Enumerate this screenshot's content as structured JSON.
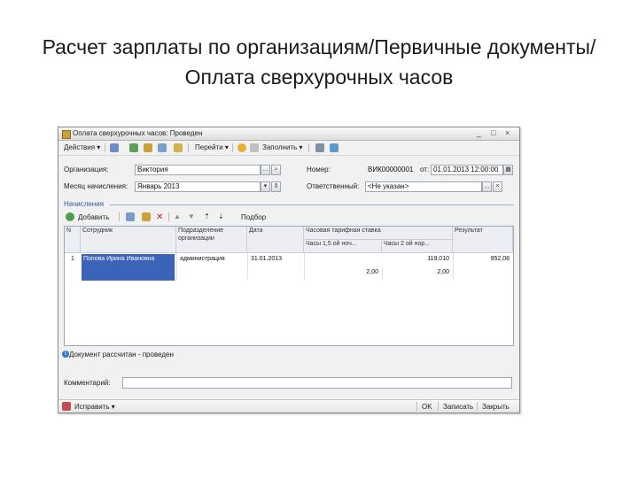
{
  "slide": {
    "title": "Расчет зарплаты по организациям/Первичные документы/Оплата сверхурочных часов"
  },
  "window": {
    "title": "Оплата сверхурочных часов: Проведен",
    "minimize": "_",
    "restore": "□",
    "close": "×"
  },
  "toolbar": {
    "actions": "Действия ▾",
    "goto": "Перейти ▾",
    "fill": "Заполнить ▾"
  },
  "form": {
    "org_label": "Организация:",
    "org_value": "Виктория",
    "number_label": "Номер:",
    "number_value": "ВИК00000001",
    "from_label": "от:",
    "date_value": "01.01.2013 12:00:00",
    "month_label": "Месяц начисления:",
    "month_value": "Январь 2013",
    "responsible_label": "Ответственный:",
    "responsible_value": "<Не указан>"
  },
  "section": {
    "title": "Начисления"
  },
  "grid_toolbar": {
    "add": "Добавить",
    "select": "Подбор"
  },
  "grid": {
    "headers": {
      "num": "N",
      "employee": "Сотрудник",
      "dept": "Подразделение организации",
      "date": "Дата",
      "rate": "Часовая тарифная ставка",
      "sub1": "Часы 1,5 ой ноч...",
      "sub2": "Часы 2 ой нор...",
      "result": "Результат"
    },
    "row": {
      "num": "1",
      "employee": "Попова Ирина Ивановна",
      "dept": "администрация",
      "date": "31.01.2013",
      "rate": "119,010",
      "result": "952,08",
      "hours1": "2,00",
      "hours2": "2,00"
    }
  },
  "status": {
    "message": "Документ рассчитан - проведен"
  },
  "comment": {
    "label": "Комментарий:"
  },
  "bottom": {
    "print": "Исправить ▾",
    "ok": "OK",
    "save": "Записать",
    "close": "Закрыть"
  },
  "colors": {
    "accent": "#2a5aa8",
    "selection": "#3b63b8"
  }
}
